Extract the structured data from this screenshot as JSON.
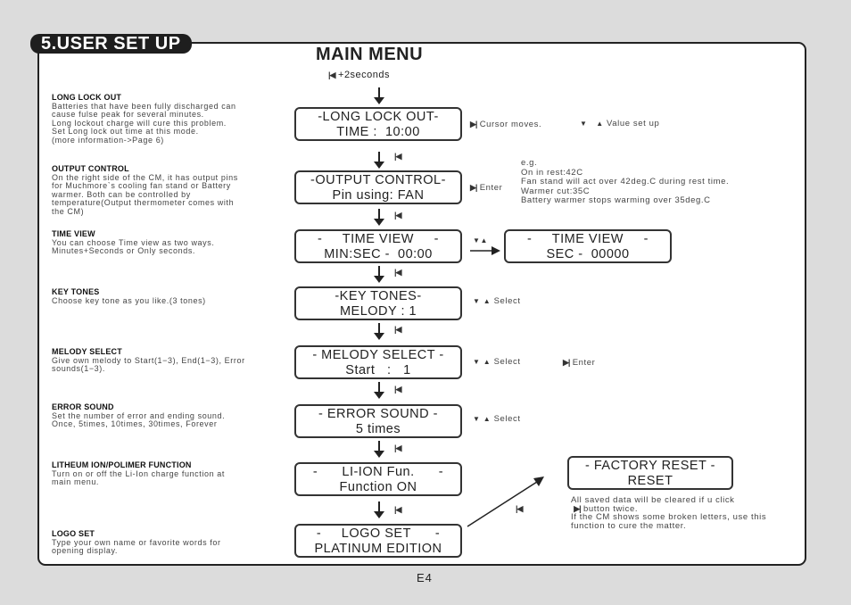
{
  "section_tab": "5.USER SET UP",
  "main_title": "MAIN MENU",
  "main_hint": "+2seconds",
  "icons": {
    "back": "|◀",
    "enter": "▶|",
    "down": "▼",
    "up": "▲"
  },
  "descriptions": [
    {
      "title": "LONG LOCK OUT",
      "lines": [
        "Batteries that have been fully discharged can",
        "cause fulse peak for several minutes.",
        "Long lockout charge will cure this problem.",
        "Set Long lock out time at this mode.",
        "(more information->Page 6)"
      ]
    },
    {
      "title": "OUTPUT CONTROL",
      "lines": [
        "On the right side of the CM, it has output pins",
        "for Muchmore`s cooling fan stand or Battery",
        "warmer. Both can be controlled by",
        "temperature(Output thermometer comes with",
        "the CM)"
      ]
    },
    {
      "title": "TIME VIEW",
      "lines": [
        "You can choose Time view as two ways.",
        "Minutes+Seconds or Only seconds."
      ]
    },
    {
      "title": "KEY TONES",
      "lines": [
        "Choose key tone as you like.(3 tones)"
      ]
    },
    {
      "title": "MELODY SELECT",
      "lines": [
        "Give own melody to Start(1−3), End(1−3), Error",
        "sounds(1−3)."
      ]
    },
    {
      "title": "ERROR SOUND",
      "lines": [
        "Set the number of error and ending sound.",
        "Once, 5times, 10times, 30times, Forever"
      ]
    },
    {
      "title": "LITHEUM ION/POLIMER FUNCTION",
      "lines": [
        "Turn on or off the Li-Ion charge function at",
        "main menu."
      ]
    },
    {
      "title": "LOGO SET",
      "lines": [
        "Type your own name or favorite words for",
        "opening display."
      ]
    }
  ],
  "screens": [
    {
      "line1": "-LONG LOCK OUT-",
      "line2": "TIME :  10:00"
    },
    {
      "line1": "-OUTPUT CONTROL-",
      "line2": "Pin using: FAN"
    },
    {
      "line1": "-     TIME VIEW     -",
      "line2": "MIN:SEC -  00:00"
    },
    {
      "line1": "-KEY TONES-",
      "line2": "MELODY : 1"
    },
    {
      "line1": "- MELODY SELECT -",
      "line2": "Start   :   1"
    },
    {
      "line1": "- ERROR SOUND -",
      "line2": "5 times"
    },
    {
      "line1": "-      LI-ION Fun.      -",
      "line2": "Function ON"
    },
    {
      "line1": "-     LOGO SET      -",
      "line2": "PLATINUM EDITION"
    }
  ],
  "time_view_alt": {
    "line1": "-     TIME VIEW     -",
    "line2": "SEC -  00000"
  },
  "factory_reset": {
    "line1": "- FACTORY RESET -",
    "line2": "RESET",
    "note_line1": "All saved data will be cleared if u click",
    "note_line2": "button twice.",
    "note_line3": "If the CM shows some broken letters, use this",
    "note_line4": "function to cure the matter."
  },
  "notes": {
    "long_lock_cursor": "Cursor moves.",
    "long_lock_value": "Value set up",
    "output_enter": "Enter",
    "output_example": [
      "e.g.",
      "On in rest:42C",
      "Fan stand will act over 42deg.C during rest time.",
      "Warmer cut:35C",
      "Battery warmer stops warming over 35deg.C"
    ],
    "key_tones_select": "Select",
    "melody_select": "Select",
    "melody_enter": "Enter",
    "error_select": "Select"
  },
  "page_number": "E4"
}
